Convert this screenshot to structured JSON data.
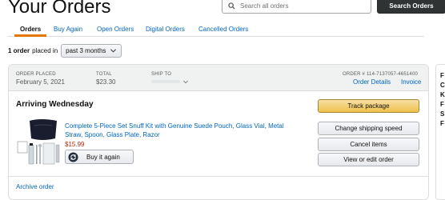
{
  "page": {
    "title": "Your Orders"
  },
  "search": {
    "placeholder": "Search all orders",
    "button_label": "Search Orders"
  },
  "tabs": [
    {
      "label": "Orders",
      "active": true
    },
    {
      "label": "Buy Again"
    },
    {
      "label": "Open Orders"
    },
    {
      "label": "Digital Orders"
    },
    {
      "label": "Cancelled Orders"
    }
  ],
  "filter": {
    "count_text": "1 order",
    "rest_text": "placed in",
    "period": "past 3 months"
  },
  "order": {
    "placed_label": "ORDER PLACED",
    "placed_value": "February 5, 2021",
    "total_label": "TOTAL",
    "total_value": "$23.30",
    "ship_label": "SHIP TO",
    "number_label": "ORDER # 114-7137057-4651400",
    "details_link": "Order Details",
    "invoice_link": "Invoice",
    "status": "Arriving Wednesday",
    "product_title": "Complete 5-Piece Set Snuff Kit with Genuine Suede Pouch, Glass Vial, Metal Straw, Spoon, Glass Plate, Razor",
    "price": "$15.99",
    "buy_again_label": "Buy it again",
    "actions": {
      "track": "Track package",
      "change_speed": "Change shipping speed",
      "cancel": "Cancel items",
      "view_edit": "View or edit order"
    },
    "archive_link": "Archive order"
  },
  "side_panel": {
    "letters": [
      "F",
      "C",
      "K",
      "F",
      "S",
      "F"
    ]
  },
  "colors": {
    "link": "#0066c0",
    "price": "#b12704",
    "tab_accent": "#e77600",
    "search_button": "#303333",
    "track_button": "#f0c14b"
  },
  "icons": [
    "search-icon",
    "chevron-down-icon",
    "buy-again-cycle-icon"
  ]
}
